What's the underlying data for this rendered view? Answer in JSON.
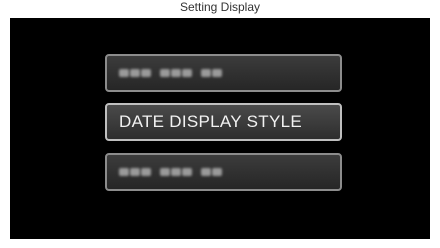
{
  "header": {
    "title": "Setting Display"
  },
  "menu": {
    "items": [
      {
        "label": "",
        "state": "obscured"
      },
      {
        "label": "DATE DISPLAY STYLE",
        "state": "selected"
      },
      {
        "label": "",
        "state": "obscured"
      }
    ]
  },
  "colors": {
    "screen_bg": "#000000",
    "item_border": "#8c8c8c",
    "selected_border": "#bfbfbf",
    "text": "#f2f2f2"
  }
}
